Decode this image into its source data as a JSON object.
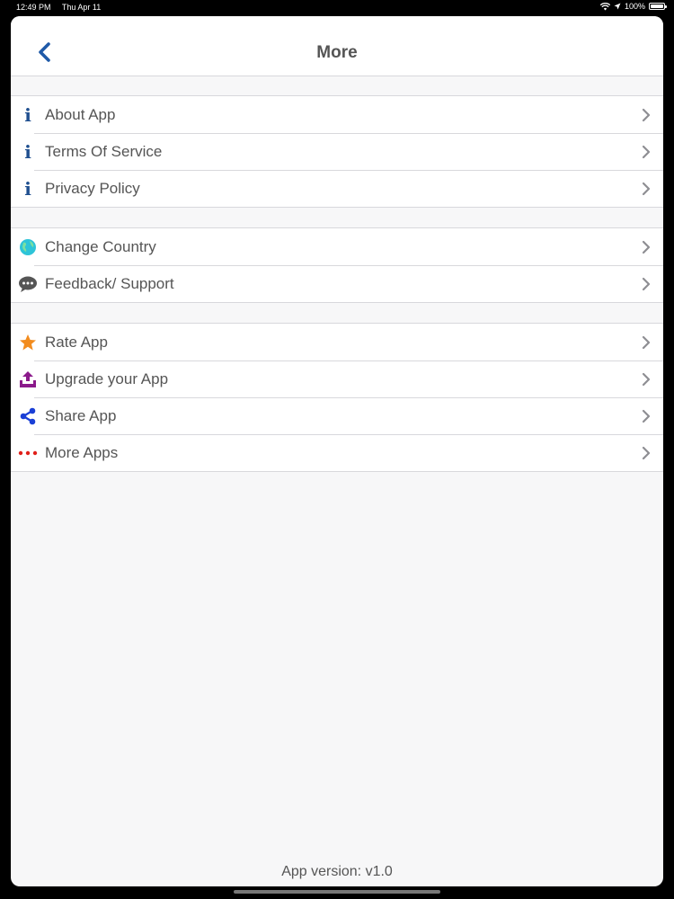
{
  "status_bar": {
    "time": "12:49 PM",
    "date": "Thu Apr 11",
    "battery": "100%"
  },
  "nav": {
    "title": "More"
  },
  "groups": [
    {
      "items": [
        {
          "label": "About App",
          "icon": "info-icon",
          "icon_color": "#1f4f8f"
        },
        {
          "label": "Terms Of Service",
          "icon": "info-icon",
          "icon_color": "#1f4f8f"
        },
        {
          "label": "Privacy Policy",
          "icon": "info-icon",
          "icon_color": "#1f4f8f"
        }
      ]
    },
    {
      "items": [
        {
          "label": "Change Country",
          "icon": "globe-icon",
          "icon_color": "#2ec4d8"
        },
        {
          "label": "Feedback/ Support",
          "icon": "chat-bubble-icon",
          "icon_color": "#555555"
        }
      ]
    },
    {
      "items": [
        {
          "label": "Rate App",
          "icon": "star-icon",
          "icon_color": "#f28c1e"
        },
        {
          "label": "Upgrade your App",
          "icon": "upload-icon",
          "icon_color": "#8b1a8b"
        },
        {
          "label": "Share App",
          "icon": "share-icon",
          "icon_color": "#1a3fd6"
        },
        {
          "label": "More Apps",
          "icon": "more-dots-icon",
          "icon_color": "#e0201a"
        }
      ]
    }
  ],
  "footer": {
    "version": "App version: v1.0"
  }
}
